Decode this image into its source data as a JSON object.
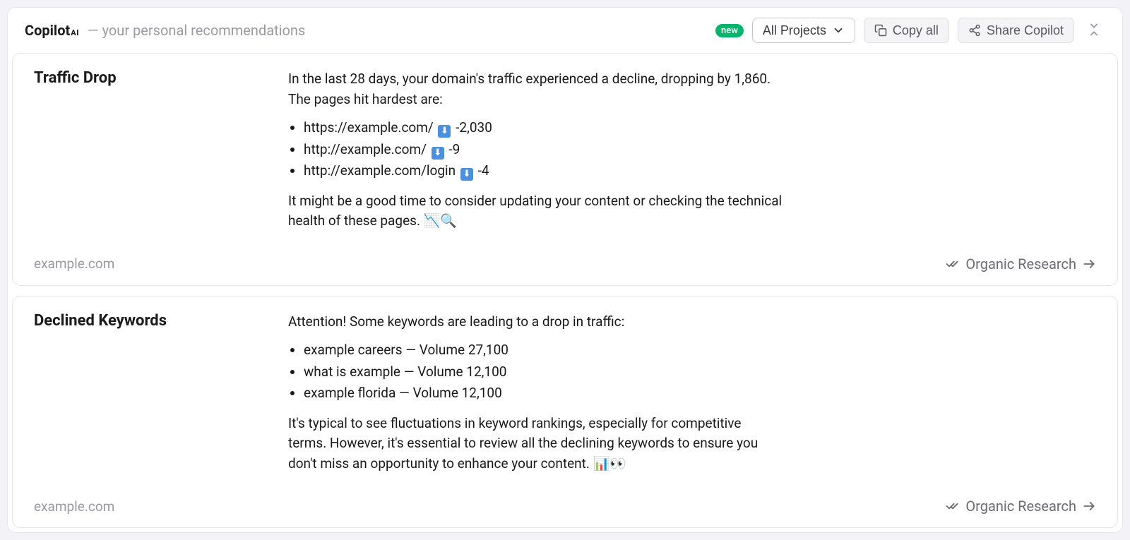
{
  "header": {
    "title_main": "Copilot",
    "title_sup": "AI",
    "subtitle": "— your personal recommendations",
    "badge": "new",
    "project_selector": "All Projects",
    "copy_all": "Copy all",
    "share": "Share Copilot"
  },
  "cards": [
    {
      "title": "Traffic Drop",
      "intro": "In the last 28 days, your domain's traffic experienced a decline, dropping by 1,860. The pages hit hardest are:",
      "items": [
        {
          "url": "https://example.com/",
          "delta": "-2,030"
        },
        {
          "url": "http://example.com/",
          "delta": "-9"
        },
        {
          "url": "http://example.com/login",
          "delta": "-4"
        }
      ],
      "outro": "It might be a good time to consider updating your content or checking the technical health of these pages. 📉🔍",
      "domain": "example.com",
      "link_label": "Organic Research"
    },
    {
      "title": "Declined Keywords",
      "intro": "Attention! Some keywords are leading to a drop in traffic:",
      "items": [
        {
          "keyword": "example careers",
          "volume": "27,100"
        },
        {
          "keyword": "what is example",
          "volume": "12,100"
        },
        {
          "keyword": "example florida",
          "volume": "12,100"
        }
      ],
      "outro": "It's typical to see fluctuations in keyword rankings, especially for competitive terms. However, it's essential to review all the declining keywords to ensure you don't miss an opportunity to enhance your content. 📊👀",
      "domain": "example.com",
      "link_label": "Organic Research"
    }
  ]
}
